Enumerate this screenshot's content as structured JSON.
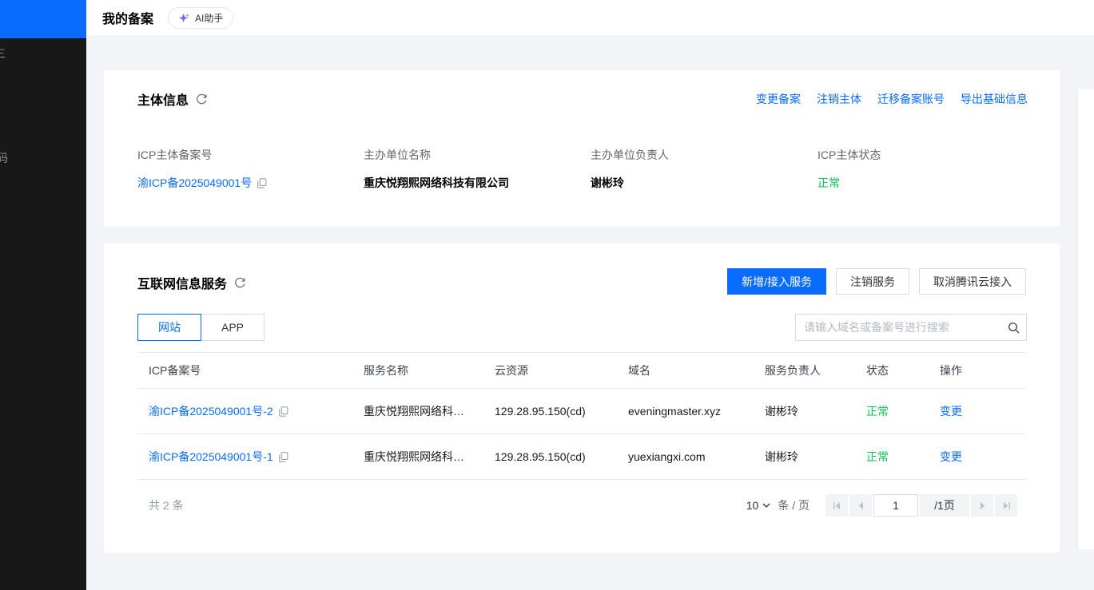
{
  "colors": {
    "accent": "#0a6cff",
    "success": "#0abf5b",
    "sidebar_bg": "#181818"
  },
  "icons": {
    "ai_sparkle": "✦",
    "refresh": "⟳",
    "copy": "⧉",
    "search": "⌕",
    "chevron_down": "∨",
    "page_first": "⏮",
    "page_prev": "◀",
    "page_next": "▶",
    "page_last": "⏭"
  },
  "sidebar": {
    "partial_items": [
      {
        "label": "三"
      },
      {
        "label": "码"
      }
    ]
  },
  "header": {
    "title": "我的备案",
    "ai_button": "AI助手"
  },
  "subject_card": {
    "title": "主体信息",
    "actions": [
      "变更备案",
      "注销主体",
      "迁移备案账号",
      "导出基础信息"
    ],
    "fields": [
      {
        "label": "ICP主体备案号",
        "value": "渝ICP备2025049001号"
      },
      {
        "label": "主办单位名称",
        "value": "重庆悦翔熙网络科技有限公司"
      },
      {
        "label": "主办单位负责人",
        "value": "谢彬玲"
      },
      {
        "label": "ICP主体状态",
        "value": "正常"
      }
    ]
  },
  "service_card": {
    "title": "互联网信息服务",
    "primary_button": "新增/接入服务",
    "secondary_buttons": [
      "注销服务",
      "取消腾讯云接入"
    ],
    "tabs": [
      {
        "label": "网站",
        "active": true
      },
      {
        "label": "APP",
        "active": false
      }
    ],
    "search_placeholder": "请输入域名或备案号进行搜索",
    "table": {
      "columns": [
        "ICP备案号",
        "服务名称",
        "云资源",
        "域名",
        "服务负责人",
        "状态",
        "操作"
      ],
      "rows": [
        {
          "icp_no": "渝ICP备2025049001号-2",
          "service_name": "重庆悦翔熙网络科技...",
          "cloud_resource": "129.28.95.150(cd)",
          "domain": "eveningmaster.xyz",
          "owner": "谢彬玲",
          "status": "正常",
          "action": "变更"
        },
        {
          "icp_no": "渝ICP备2025049001号-1",
          "service_name": "重庆悦翔熙网络科技...",
          "cloud_resource": "129.28.95.150(cd)",
          "domain": "yuexiangxi.com",
          "owner": "谢彬玲",
          "status": "正常",
          "action": "变更"
        }
      ]
    },
    "pagination": {
      "total": "共 2 条",
      "page_size": "10",
      "unit": "条 / 页",
      "current_page": "1",
      "total_pages": "/1页"
    }
  }
}
